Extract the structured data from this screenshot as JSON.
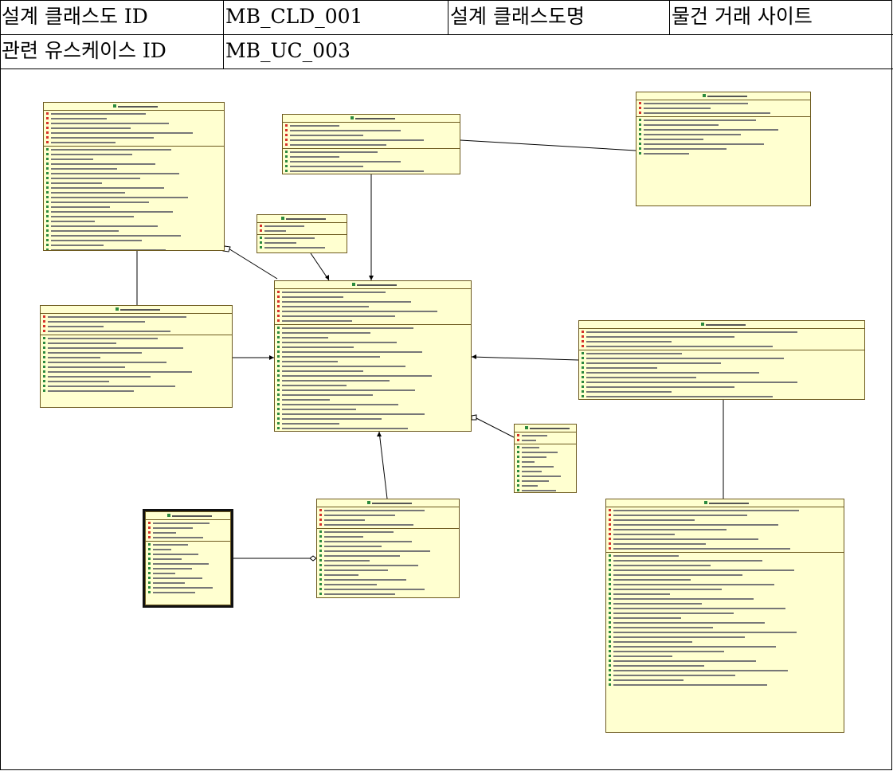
{
  "header": {
    "row1": {
      "label_id": "설계 클래스도 ID",
      "value_id": "MB_CLD_001",
      "label_name": "설계 클래스도명",
      "value_name": "물건 거래 사이트"
    },
    "row2": {
      "label_uc": "관련 유스케이스 ID",
      "value_uc": "MB_UC_003"
    }
  },
  "colors": {
    "class_fill": "#ffffd0",
    "class_border": "#6d5a1f",
    "private_marker": "#d6312a",
    "public_marker": "#2b8a3e"
  },
  "classes": [
    {
      "name": "class-box-member-vo",
      "attr_rows": 7,
      "method_rows": 22
    },
    {
      "name": "class-box-board-service",
      "attr_rows": 3,
      "method_rows": 8
    },
    {
      "name": "class-box-board-service-impl-top",
      "attr_rows": 5,
      "method_rows": 16
    },
    {
      "name": "class-box-small-interface",
      "attr_rows": 2,
      "method_rows": 3
    },
    {
      "name": "class-box-member-service-impl",
      "attr_rows": 4,
      "method_rows": 12
    },
    {
      "name": "class-box-board-vo-center",
      "attr_rows": 7,
      "method_rows": 22
    },
    {
      "name": "class-box-trade-service-impl",
      "attr_rows": 4,
      "method_rows": 10
    },
    {
      "name": "class-box-category-vo",
      "attr_rows": 2,
      "method_rows": 10
    },
    {
      "name": "class-box-selected-controller",
      "attr_rows": 4,
      "method_rows": 11
    },
    {
      "name": "class-box-reply-vo",
      "attr_rows": 4,
      "method_rows": 16
    },
    {
      "name": "class-box-trade-vo",
      "attr_rows": 9,
      "method_rows": 28
    }
  ]
}
